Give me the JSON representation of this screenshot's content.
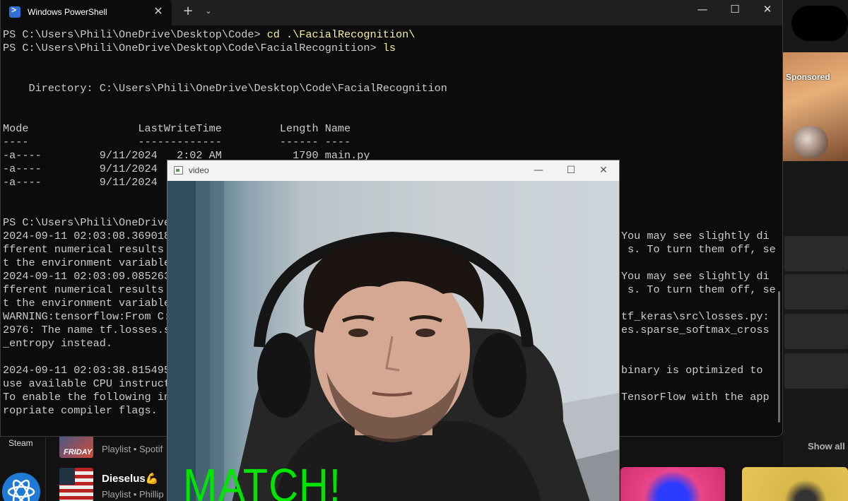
{
  "background_app": {
    "sponsored_label": "Sponsored",
    "show_all_label": "Show all",
    "steam_label": "Steam",
    "playlists": [
      {
        "title": "",
        "subtitle": "Playlist • Spotif",
        "thumb_text": "FRIDAY"
      },
      {
        "title": "Dieselus💪",
        "subtitle": "Playlist • Phillip"
      }
    ]
  },
  "powershell": {
    "tab_title": "Windows PowerShell",
    "tab_icon": "powershell-icon",
    "new_tab_label": "+",
    "lines": [
      {
        "prompt": "PS C:\\Users\\Phili\\OneDrive\\Desktop\\Code> ",
        "cmd": "cd .\\FacialRecognition\\"
      },
      {
        "prompt": "PS C:\\Users\\Phili\\OneDrive\\Desktop\\Code\\FacialRecognition> ",
        "cmd": "ls"
      },
      {
        "prompt": "",
        "cmd": ""
      },
      {
        "prompt": "",
        "cmd": ""
      },
      {
        "prompt": "    Directory: C:\\Users\\Phili\\OneDrive\\Desktop\\Code\\FacialRecognition",
        "cmd": ""
      },
      {
        "prompt": "",
        "cmd": ""
      },
      {
        "prompt": "",
        "cmd": ""
      },
      {
        "prompt": "Mode                 LastWriteTime         Length Name",
        "cmd": ""
      },
      {
        "prompt": "----                 -------------         ------ ----",
        "cmd": ""
      },
      {
        "prompt": "-a----         9/11/2024   2:02 AM           1790 main.py",
        "cmd": ""
      },
      {
        "prompt": "-a----         9/11/2024",
        "cmd": ""
      },
      {
        "prompt": "-a----         9/11/2024",
        "cmd": ""
      },
      {
        "prompt": "",
        "cmd": ""
      },
      {
        "prompt": "",
        "cmd": ""
      },
      {
        "prompt": "PS C:\\Users\\Phili\\OneDrive",
        "cmd": ""
      },
      {
        "prompt": "2024-09-11 02:03:08.369018                                                                      You may see slightly di",
        "cmd": ""
      },
      {
        "prompt": "fferent numerical results                                                                        s. To turn them off, se",
        "cmd": ""
      },
      {
        "prompt": "t the environment variable",
        "cmd": ""
      },
      {
        "prompt": "2024-09-11 02:03:09.085263                                                                      You may see slightly di",
        "cmd": ""
      },
      {
        "prompt": "fferent numerical results                                                                        s. To turn them off, se",
        "cmd": ""
      },
      {
        "prompt": "t the environment variable",
        "cmd": ""
      },
      {
        "prompt": "WARNING:tensorflow:From C:                                                                      tf_keras\\src\\losses.py:",
        "cmd": ""
      },
      {
        "prompt": "2976: The name tf.losses.s                                                                      es.sparse_softmax_cross",
        "cmd": ""
      },
      {
        "prompt": "_entropy instead.",
        "cmd": ""
      },
      {
        "prompt": "",
        "cmd": ""
      },
      {
        "prompt": "2024-09-11 02:03:38.815495                                                                      binary is optimized to",
        "cmd": ""
      },
      {
        "prompt": "use available CPU instruct",
        "cmd": ""
      },
      {
        "prompt": "To enable the following in                                                                      TensorFlow with the app",
        "cmd": ""
      },
      {
        "prompt": "ropriate compiler flags.",
        "cmd": ""
      }
    ]
  },
  "video_window": {
    "title": "video",
    "overlay_text": "MATCH!",
    "overlay_color": "#00e600"
  },
  "colors": {
    "terminal_bg": "#0c0c0c",
    "terminal_text": "#cccccc",
    "command_text": "#f9f1a5"
  }
}
